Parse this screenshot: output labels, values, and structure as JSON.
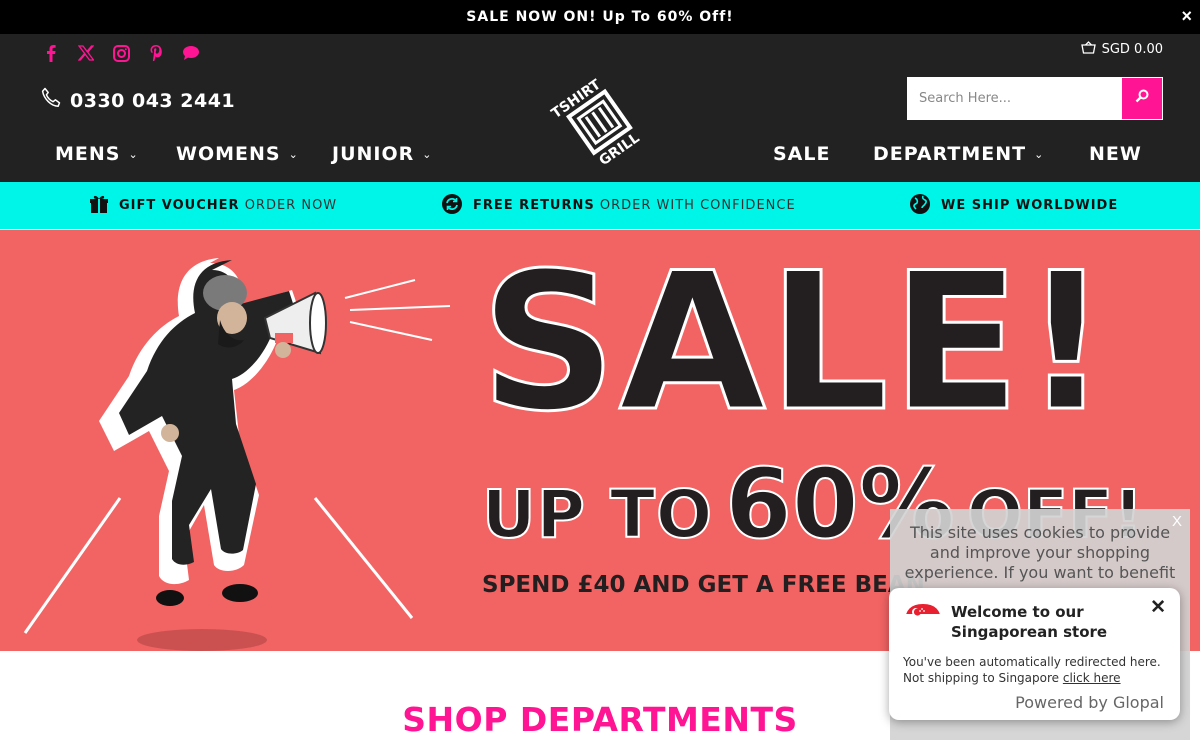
{
  "announcement": {
    "text": "SALE NOW ON! Up To 60% Off!",
    "close": "×"
  },
  "header": {
    "phone": "0330 043 2441",
    "cart_total": "SGD 0.00",
    "search_placeholder": "Search Here...",
    "socials": [
      "facebook-icon",
      "x-icon",
      "instagram-icon",
      "pinterest-icon",
      "chat-icon"
    ]
  },
  "nav": {
    "left": [
      {
        "label": "MENS",
        "dropdown": true
      },
      {
        "label": "WOMENS",
        "dropdown": true
      },
      {
        "label": "JUNIOR",
        "dropdown": true
      }
    ],
    "right": [
      {
        "label": "SALE",
        "dropdown": false
      },
      {
        "label": "DEPARTMENT",
        "dropdown": true
      },
      {
        "label": "NEW",
        "dropdown": false
      }
    ]
  },
  "usp": [
    {
      "bold": "GIFT VOUCHER",
      "light": "ORDER NOW",
      "icon": "gift-icon"
    },
    {
      "bold": "FREE RETURNS",
      "light": "ORDER WITH CONFIDENCE",
      "icon": "refresh-icon"
    },
    {
      "bold": "WE SHIP WORLDWIDE",
      "light": "",
      "icon": "globe-icon"
    }
  ],
  "hero": {
    "headline": "SALE!",
    "upto_a": "UP TO",
    "upto_b": "60%",
    "upto_c": "OFF!",
    "subline": "SPEND £40 AND GET A FREE BEAN"
  },
  "shop_title": "SHOP DEPARTMENTS",
  "cookie": {
    "text": "This site uses cookies to provide and improve your shopping experience. If you want to benefit",
    "close": "X"
  },
  "glopal": {
    "title": "Welcome to our Singaporean store",
    "message": "You've been automatically redirected here. Not shipping to Singapore",
    "link": "click here",
    "powered": "Powered by Glopal",
    "close": "✕"
  },
  "colors": {
    "accent": "#ff1493",
    "header_bg": "#222222",
    "usp_bg": "#00f5e9",
    "hero_bg": "#f26464"
  }
}
